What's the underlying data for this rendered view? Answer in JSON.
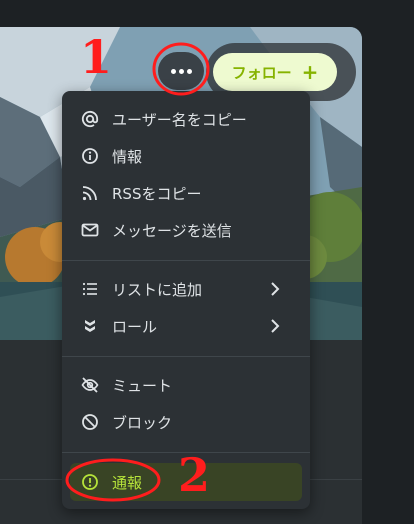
{
  "header": {
    "more_label": "…",
    "follow_label": "フォロー"
  },
  "menu": {
    "copy_username": "ユーザー名をコピー",
    "info": "情報",
    "copy_rss": "RSSをコピー",
    "send_message": "メッセージを送信",
    "add_to_list": "リストに追加",
    "roles": "ロール",
    "mute": "ミュート",
    "block": "ブロック",
    "report": "通報"
  },
  "annotations": {
    "step1": "1",
    "step2": "2"
  },
  "colors": {
    "accent": "#86b300",
    "report_text": "#b6e33a",
    "annotation": "#ff1d1d"
  }
}
